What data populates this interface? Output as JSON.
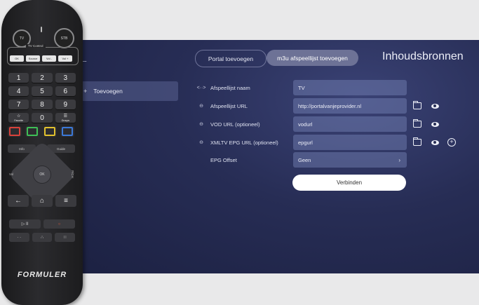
{
  "remote": {
    "tv_label": "TV",
    "stb_label": "STB",
    "tv_control_label": "TV Control",
    "tv_buttons": [
      "OK",
      "Source",
      "Vol -",
      "Vol +"
    ],
    "number_keys": [
      "1",
      "2",
      "3",
      "4",
      "5",
      "6",
      "7",
      "8",
      "9",
      "☆",
      "0",
      "☰"
    ],
    "number_subs": [
      "",
      "",
      "",
      "",
      "",
      "",
      "",
      "",
      "",
      "Favorite",
      "",
      "Groups"
    ],
    "info_label": "Info",
    "guide_label": "Guide",
    "ok_label": "OK",
    "vol_label": "Vol",
    "ch_label": "P/CH",
    "nav_keys": [
      "←",
      "⌂",
      "≡"
    ],
    "play_keys": [
      "▷ II",
      "○"
    ],
    "dot_keys": [
      "· ·",
      "∴",
      "∷"
    ],
    "color_keys": [
      "#d9423a",
      "#3fbf56",
      "#e2c22e",
      "#3b79d8"
    ],
    "brand": "FORMULER"
  },
  "screen": {
    "back_icon": "←",
    "sidebar": {
      "plus": "+",
      "label": "Toevoegen"
    },
    "tabs": [
      {
        "label": "Portal toevoegen"
      },
      {
        "label": "m3u afspeellijst toevoegen"
      }
    ],
    "title": "Inhoudsbronnen",
    "form": [
      {
        "icon": "<··>",
        "label": "Afspeellijst naam",
        "value": "TV"
      },
      {
        "icon": "⊖",
        "label": "Afspeellijst URL",
        "value": "http://portalvanjeprovider.nl"
      },
      {
        "icon": "⊖",
        "label": "VOD URL (optioneel)",
        "value": "vodurl"
      },
      {
        "icon": "⊖",
        "label": "XMLTV EPG URL (optioneel)",
        "value": "epgurl"
      },
      {
        "icon": "◑",
        "label": "EPG Offset",
        "value": "Geen",
        "chevron": "›"
      }
    ],
    "connect_label": "Verbinden"
  }
}
